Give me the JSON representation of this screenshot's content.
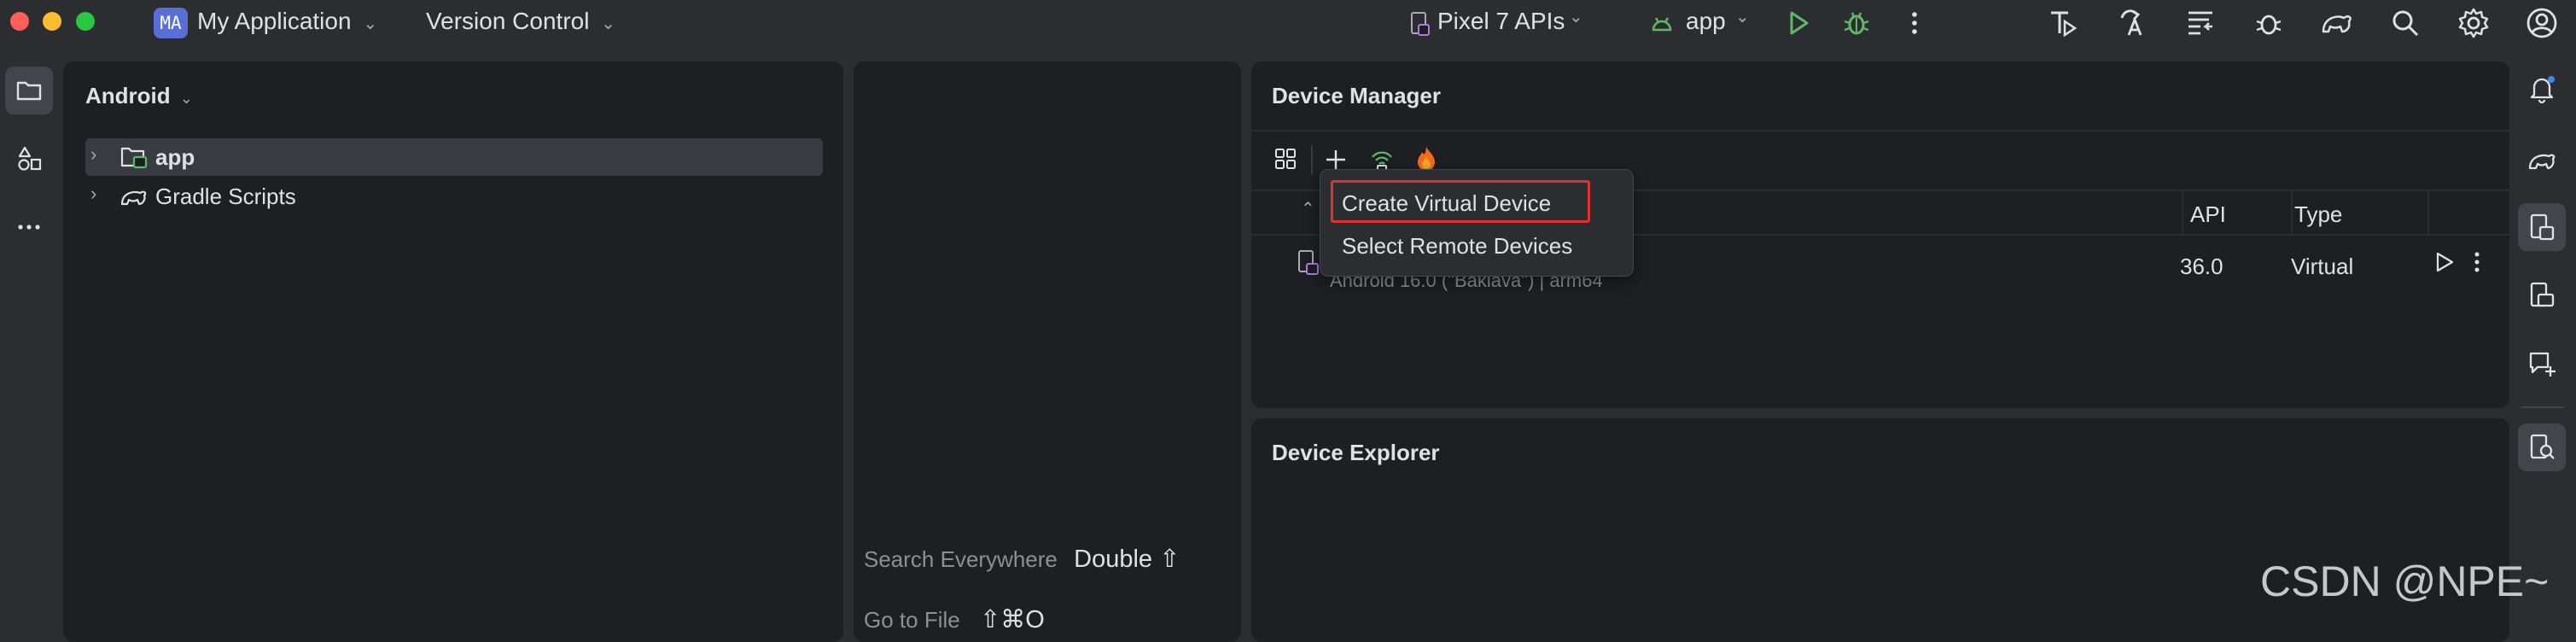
{
  "titlebar": {
    "project_badge": "MA",
    "project_name": "My Application",
    "vcs_label": "Version Control",
    "device_label": "Pixel 7 APIs",
    "run_config": "app",
    "colors": {
      "run": "#5fb865",
      "debug": "#5fb865",
      "badge": "#5a6fd6"
    }
  },
  "project_panel": {
    "view_selector": "Android",
    "tree": [
      {
        "label": "app"
      },
      {
        "label": "Gradle Scripts"
      }
    ]
  },
  "editor": {
    "hints": [
      {
        "action": "Search Everywhere",
        "shortcut": "Double ⇧"
      },
      {
        "action": "Go to File",
        "shortcut": "⇧⌘O"
      }
    ]
  },
  "device_manager": {
    "title": "Device Manager",
    "columns": [
      "API",
      "Type"
    ],
    "row": {
      "subtitle": "Android 16.0 (\"Baklava\") | arm64",
      "api": "36.0",
      "type": "Virtual"
    },
    "add_menu": {
      "items": [
        "Create Virtual Device",
        "Select Remote Devices"
      ],
      "highlight_color": "#e03131"
    }
  },
  "device_explorer": {
    "title": "Device Explorer"
  },
  "watermark": "CSDN @NPE~"
}
